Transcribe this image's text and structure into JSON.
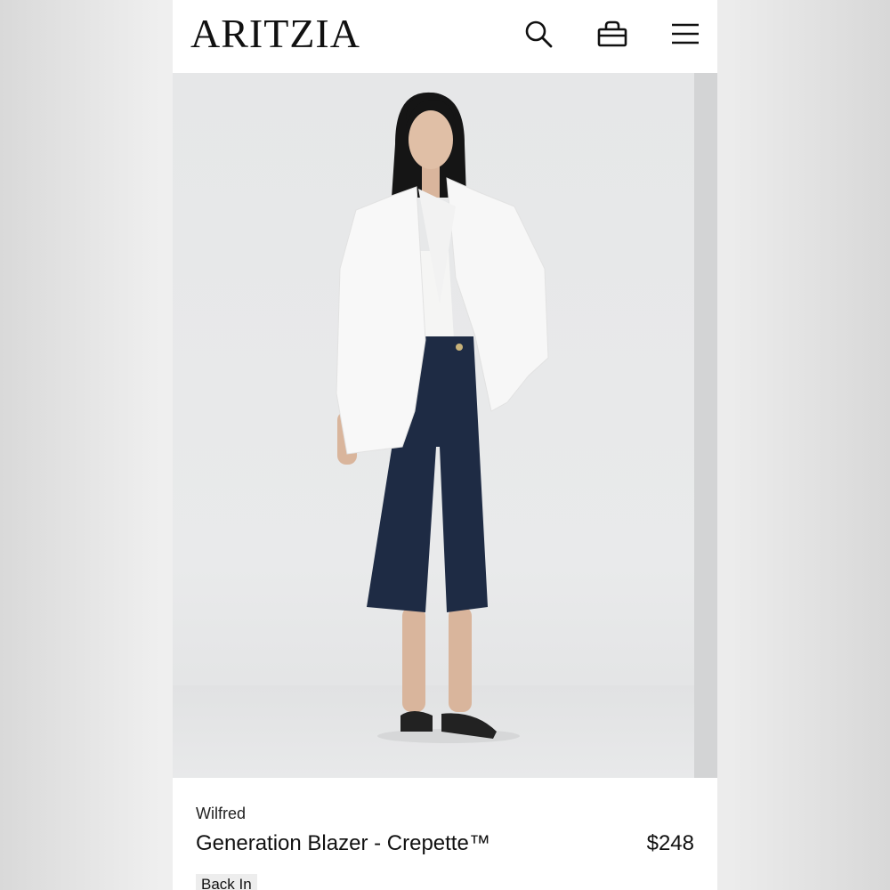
{
  "header": {
    "logo": "ARITZIA",
    "icons": [
      "search-icon",
      "bag-icon",
      "menu-icon"
    ]
  },
  "product": {
    "brand": "Wilfred",
    "name": "Generation Blazer - Crepette™",
    "price": "$248",
    "badge": "Back In"
  },
  "colors": {
    "background": "#ececec",
    "text": "#111111",
    "badge_bg": "#ededed"
  }
}
